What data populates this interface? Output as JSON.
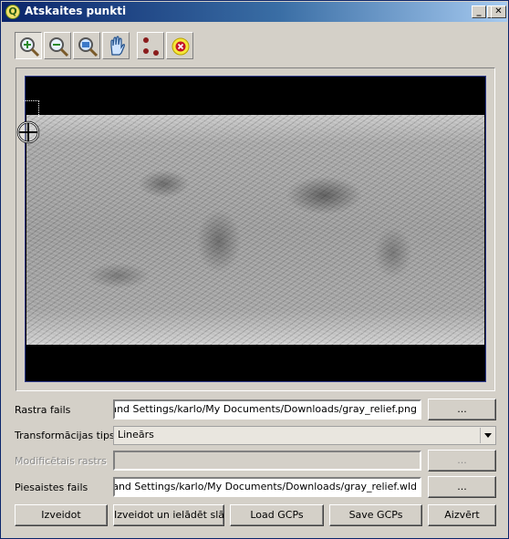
{
  "window": {
    "title": "Atskaites punkti",
    "app_icon": "qgis-icon",
    "controls": {
      "minimize": "_",
      "maximize": "□",
      "close": "✕"
    }
  },
  "toolbar": {
    "tools": [
      {
        "name": "zoom-in-icon",
        "active": true
      },
      {
        "name": "zoom-out-icon",
        "active": false
      },
      {
        "name": "zoom-full-icon",
        "active": false
      },
      {
        "name": "pan-icon",
        "active": false
      },
      {
        "name": "add-point-icon",
        "active": false
      },
      {
        "name": "delete-point-icon",
        "active": false
      }
    ]
  },
  "canvas": {
    "raster": "gray_relief"
  },
  "form": {
    "raster_file": {
      "label": "Rastra fails",
      "value": "uments and Settings/karlo/My Documents/Downloads/gray_relief.png",
      "browse_label": "..."
    },
    "transform_type": {
      "label": "Transformācijas tips",
      "value": "Lineārs"
    },
    "modified_raster": {
      "label": "Modificētais rastrs",
      "value": "",
      "browse_label": "..."
    },
    "link_file": {
      "label": "Piesaistes fails",
      "value": "uments and Settings/karlo/My Documents/Downloads/gray_relief.wld",
      "browse_label": "..."
    }
  },
  "buttons": {
    "create": "Izveidot",
    "create_and_load": "Izveidot un ielādēt slāni",
    "load_gcps": "Load GCPs",
    "save_gcps": "Save GCPs",
    "close": "Aizvērt"
  },
  "colors": {
    "title_gradient_start": "#0a246a",
    "title_gradient_end": "#a6caf0",
    "dialog_bg": "#d4d0c8",
    "canvas_bg": "#000000"
  }
}
